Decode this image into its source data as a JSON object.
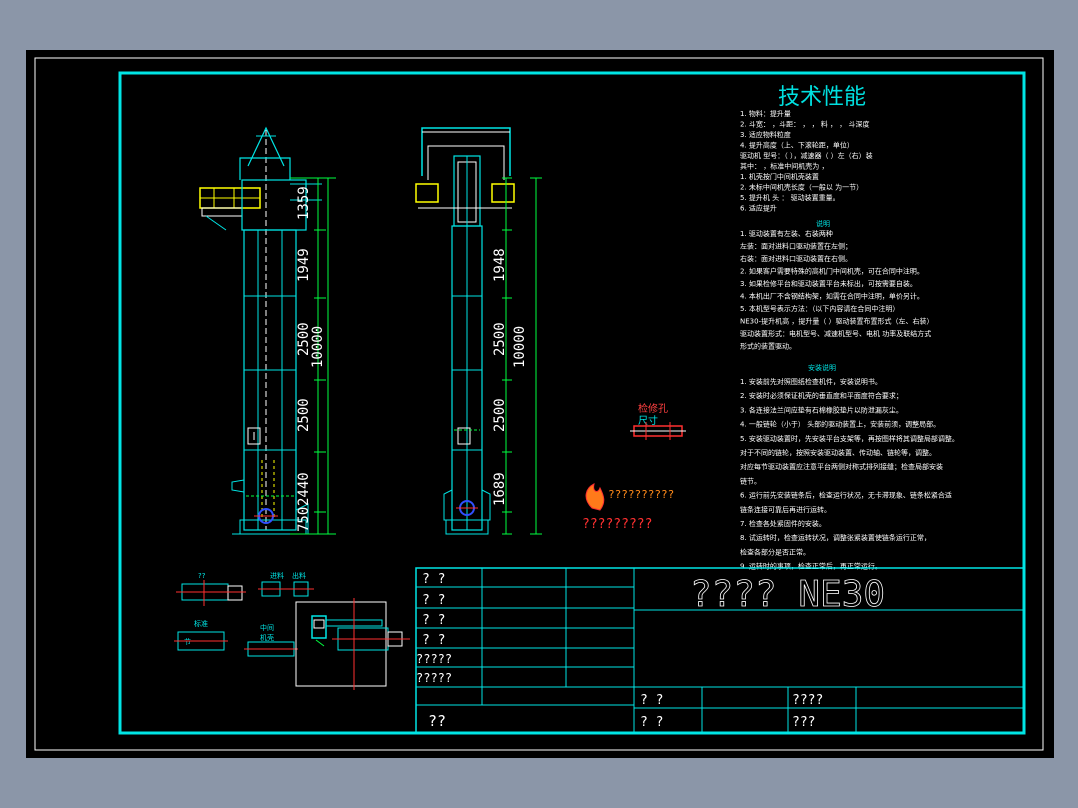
{
  "spec": {
    "heading": "技术性能",
    "lines": [
      "1. 物料：提升量",
      "2. 斗宽： ，斗距：    ，   ，  料 ，   ，   斗深度",
      "3. 适应物料粒度",
      "4. 提升高度（上、下滚轮距，单位）",
      "   驱动机 型号：（    ），减速器（   ）左（右）装",
      "   其中：  ，标准中间机壳为    ，",
      "       1. 机壳按门中间机壳装置",
      "       2. 未标中间机壳长度（一般以  为一节）",
      "5. 提升机 头 ：      驱动装置重量。",
      "6. 适应提升"
    ],
    "note_heading": "说明",
    "notes": [
      "1. 驱动装置有左装、右装两种",
      "  左装：面对进料口驱动装置在左侧；",
      "  右装：面对进料口驱动装置在右侧。",
      "2. 如果客户需要特殊的高机门中间机壳，可在合同中注明。",
      "3. 如果检修平台和驱动装置平台未标出，可按需要自装。",
      "4. 本机出厂不含钢结构架，如需在合同中注明，单价另计。",
      "5. 本机型号表示方法：（以下内容请在合同中注明）",
      "   NE30-提升机高 ，提升量（  ）驱动装置布置形式（左、右装）",
      "   驱动装置形式：电机型号、减速机型号、电机 功率及联结方式",
      "   形式的装置驱动。"
    ],
    "install_heading": "安装说明",
    "install": [
      "1. 安装前先对照图纸检查机件，安装说明书。",
      "2. 安装时必须保证机壳的垂直度和平面度符合要求；",
      "3. 各连接法兰间应垫有石棉橡胶垫片以防泄漏灰尘。",
      "4. 一般链轮（小于） 头部的驱动装置上，安装前须，调整局部。",
      "5. 安装驱动装置时，先安装平台支架等，再按图样将其调整局部调整。",
      "   对于不同的链轮，按照安装驱动装置、传动轴、链轮等，调整。",
      "   对应每节驱动装置应注意平台两侧对称式排列接缝；检查局部安装",
      "   链节。",
      "6. 运行前先安装链条后，检查运行状况，无卡滞现象、链条松紧合适",
      "   链条连接可靠后再进行运转。",
      "7. 检查各处紧固件的安装。",
      "8. 试运转时，检查运转状况，调整张紧装置使链条运行正常，",
      "   检查各部分是否正常。",
      "9. 运转时的事项，检查正常后，再正常运行。"
    ]
  },
  "elevator_left": {
    "dims": [
      "1359",
      "1949",
      "2500",
      "10000",
      "2500",
      "2440",
      "750"
    ]
  },
  "elevator_right": {
    "dims": [
      "1948",
      "2500",
      "10000",
      "2500",
      "1689"
    ]
  },
  "detail_right": {
    "label_line1": "检修孔",
    "label_line2": "尺寸"
  },
  "logo": {
    "text": "??????????",
    "caption": "?????????"
  },
  "details_bottom": {
    "label_a": "??",
    "label_b1": "进料",
    "label_b2": "出料",
    "label_c1": "标准",
    "label_c2": "节",
    "label_d1": "中间",
    "label_d2": "机壳"
  },
  "title_block": {
    "drawing_title": "????  NE30",
    "rows_left": [
      "?  ?",
      "?  ?",
      "?  ?",
      "?  ?",
      "?????",
      "?????",
      "??"
    ],
    "mid_row1": "?  ?",
    "mid_row2": "?  ?",
    "right_row1": "????",
    "right_row2": "???"
  },
  "colors": {
    "frame": "#00e5e5",
    "line_white": "#ffffff",
    "line_green": "#00ff40",
    "line_red": "#ff3030",
    "line_yellow": "#ffff00",
    "line_blue": "#3050ff"
  }
}
